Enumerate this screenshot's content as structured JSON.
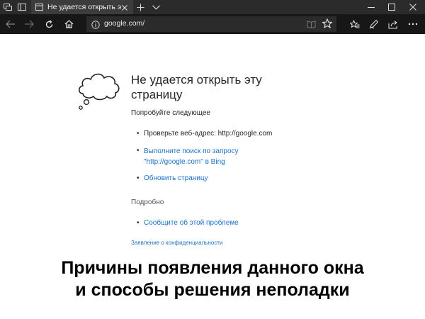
{
  "browser": {
    "tab": {
      "title": "Не удается открыть эту"
    },
    "address": {
      "url": "google.com/"
    },
    "icons": [
      "tab-manager-icon",
      "set-aside-tabs-icon",
      "close-icon",
      "new-tab-icon",
      "tab-list-chevron-icon",
      "minimize-icon",
      "maximize-icon",
      "back-icon",
      "forward-icon",
      "refresh-icon",
      "home-icon",
      "info-icon",
      "reading-view-icon",
      "favorite-star-icon",
      "favorites-hub-icon",
      "pen-icon",
      "share-icon",
      "more-icon"
    ]
  },
  "error_page": {
    "title": "Не удается открыть эту страницу",
    "try_label": "Попробуйте следующее",
    "suggestions": [
      {
        "text": "Проверьте веб-адрес: http://google.com",
        "is_link": false
      },
      {
        "text_line1": "Выполните поиск по запросу",
        "text_line2": "\"http://google.com\" в Bing",
        "is_link": true
      },
      {
        "text": "Обновить страницу",
        "is_link": true
      }
    ],
    "details_label": "Подробно",
    "details_links": [
      {
        "text": "Сообщите об этой проблеме"
      }
    ],
    "privacy_link": "Заявление о конфиденциальности"
  },
  "caption": {
    "line1": "Причины появления данного окна",
    "line2": "и способы решения неполадки"
  },
  "colors": {
    "tabbar": "#2b2b2b",
    "navbar": "#171717",
    "link": "#1a73c8",
    "text": "#262626"
  }
}
